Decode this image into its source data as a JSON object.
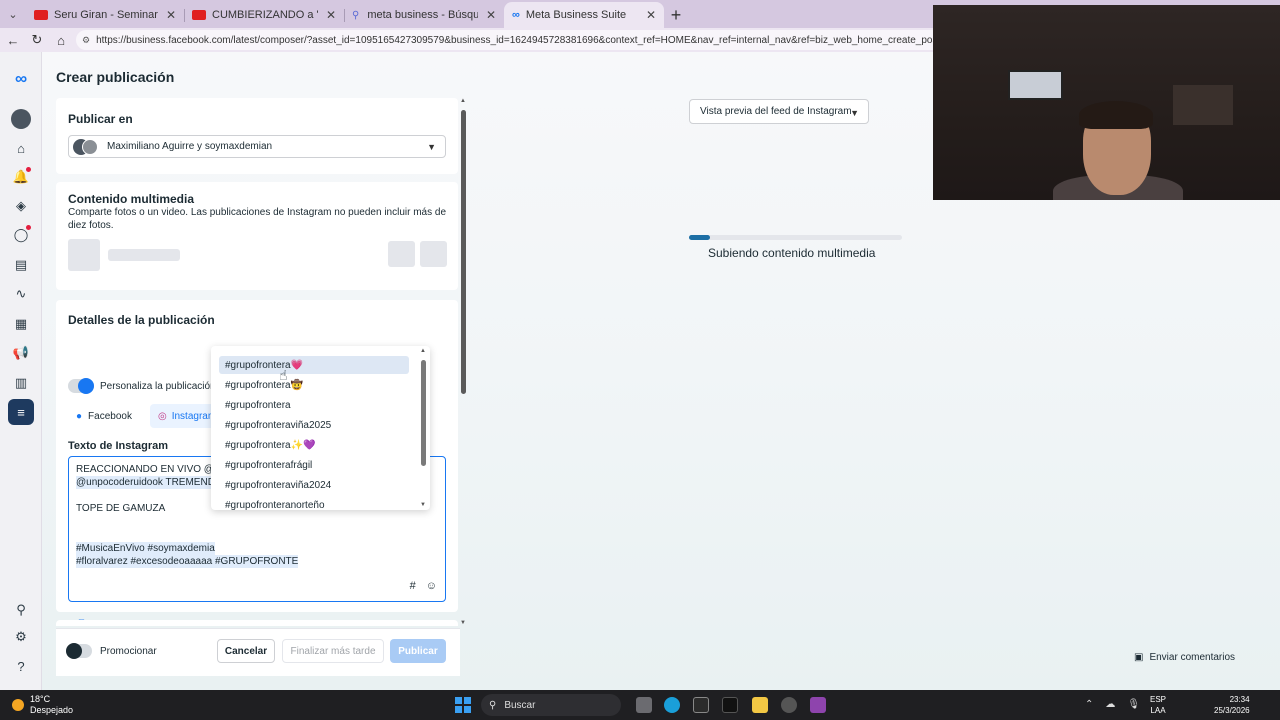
{
  "browser": {
    "tabs": [
      {
        "title": "Seru Giran - Seminare - Karaoke li",
        "favicon_color": "#e02020",
        "active": false
      },
      {
        "title": "CUMBIERIZANDO a \"Maria Becerr",
        "favicon_color": "#e02020",
        "active": false
      },
      {
        "title": "meta business - Búsqueda",
        "favicon_color": "#5b6bd6",
        "active": false
      },
      {
        "title": "Meta Business Suite",
        "favicon_color": "#1877f2",
        "active": true
      }
    ],
    "url": "https://business.facebook.com/latest/composer/?asset_id=1095165427309579&business_id=1624945728381696&context_ref=HOME&nav_ref=internal_nav&ref=biz_web_home_create_post"
  },
  "rail": {
    "icons": [
      "meta-logo-icon",
      "profile-avatar-icon",
      "home-icon",
      "notifications-icon",
      "compass-icon",
      "chat-icon",
      "pages-icon",
      "handshake-icon",
      "calendar-icon",
      "megaphone-icon",
      "insights-icon",
      "menu-icon",
      "search-icon",
      "settings-icon",
      "help-icon"
    ]
  },
  "composer": {
    "title": "Crear publicación",
    "publish_in": {
      "heading": "Publicar en",
      "selected": "Maximiliano Aguirre y soymaxdemian"
    },
    "media": {
      "heading": "Contenido multimedia",
      "description": "Comparte fotos o un video. Las publicaciones de Instagram no pueden incluir más de diez fotos."
    },
    "details": {
      "heading": "Detalles de la publicación",
      "customize_label": "Personaliza la publicación para Facebook e Instagram",
      "tabs": [
        "Facebook",
        "Instagram"
      ],
      "text_label": "Texto de Instagram",
      "text_lines": [
        "REACCIONANDO EN VIVO @F@",
        "@unpocoderuidook TREMENDO",
        "",
        "TOPE DE GAMUZA",
        "",
        "",
        "#MusicaEnVivo #soymaxdemia",
        "#floralvarez #excesodeoaaaaa #GRUPOFRONTE"
      ]
    },
    "hashtag_suggestions": [
      "#grupofrontera💗",
      "#grupofrontera🤠",
      "#grupofrontera",
      "#grupofronteraviña2025",
      "#grupofrontera✨💜",
      "#grupofronterafrágil",
      "#grupofronteraviña2024",
      "#grupofronteranorteño"
    ],
    "footer": {
      "promote_label": "Promocionar",
      "cancel": "Cancelar",
      "finish_later": "Finalizar más tarde",
      "publish": "Publicar"
    }
  },
  "preview": {
    "dropdown_label": "Vista previa del feed de Instagram",
    "upload_status": "Subiendo contenido multimedia",
    "upload_progress": 0.1,
    "feedback": "Enviar comentarios"
  },
  "taskbar": {
    "temperature": "18°C",
    "weather": "Despejado",
    "search_placeholder": "Buscar",
    "lang_top": "ESP",
    "lang_bottom": "LAA",
    "time": "23:34",
    "date": "25/3/2026"
  },
  "colors": {
    "accent": "#1877f2",
    "progress": "#1d6fa5",
    "publish_disabled": "#a9cbf5"
  }
}
